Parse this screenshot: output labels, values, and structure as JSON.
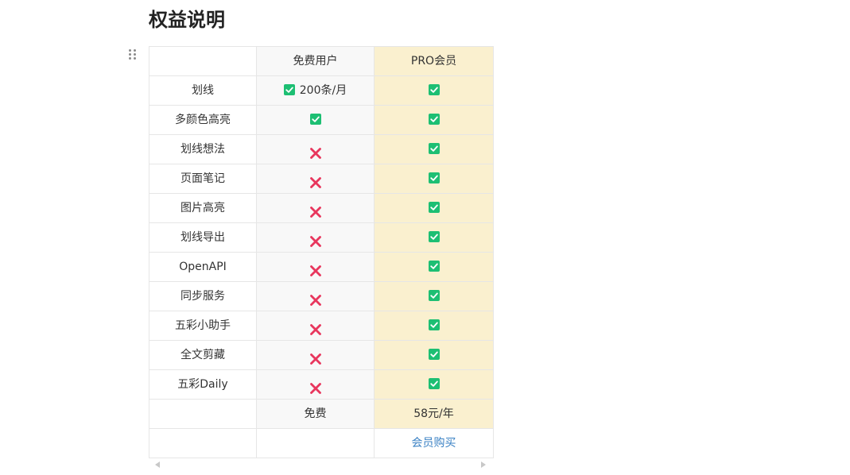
{
  "page": {
    "title": "权益说明"
  },
  "table": {
    "headers": [
      "",
      "免费用户",
      "PRO会员"
    ],
    "rows": [
      {
        "feature": "划线",
        "free": "check",
        "free_text": "200条/月",
        "pro": "check"
      },
      {
        "feature": "多颜色高亮",
        "free": "check",
        "pro": "check"
      },
      {
        "feature": "划线想法",
        "free": "cross",
        "pro": "check"
      },
      {
        "feature": "页面笔记",
        "free": "cross",
        "pro": "check"
      },
      {
        "feature": "图片高亮",
        "free": "cross",
        "pro": "check"
      },
      {
        "feature": "划线导出",
        "free": "cross",
        "pro": "check"
      },
      {
        "feature": "OpenAPI",
        "free": "cross",
        "pro": "check"
      },
      {
        "feature": "同步服务",
        "free": "cross",
        "pro": "check"
      },
      {
        "feature": "五彩小助手",
        "free": "cross",
        "pro": "check"
      },
      {
        "feature": "全文剪藏",
        "free": "cross",
        "pro": "check"
      },
      {
        "feature": "五彩Daily",
        "free": "cross",
        "pro": "check"
      }
    ],
    "price_row": {
      "feature": "",
      "free": "免费",
      "pro": "58元/年"
    },
    "buy_row": {
      "pro_link": "会员购买"
    }
  },
  "icons": {
    "check": "check-icon",
    "cross": "cross-icon",
    "drag": "drag-handle-icon"
  },
  "colors": {
    "check": "#1dbf73",
    "cross": "#e8365d",
    "pro_column": "#faf0cf",
    "link": "#3b82c4"
  }
}
